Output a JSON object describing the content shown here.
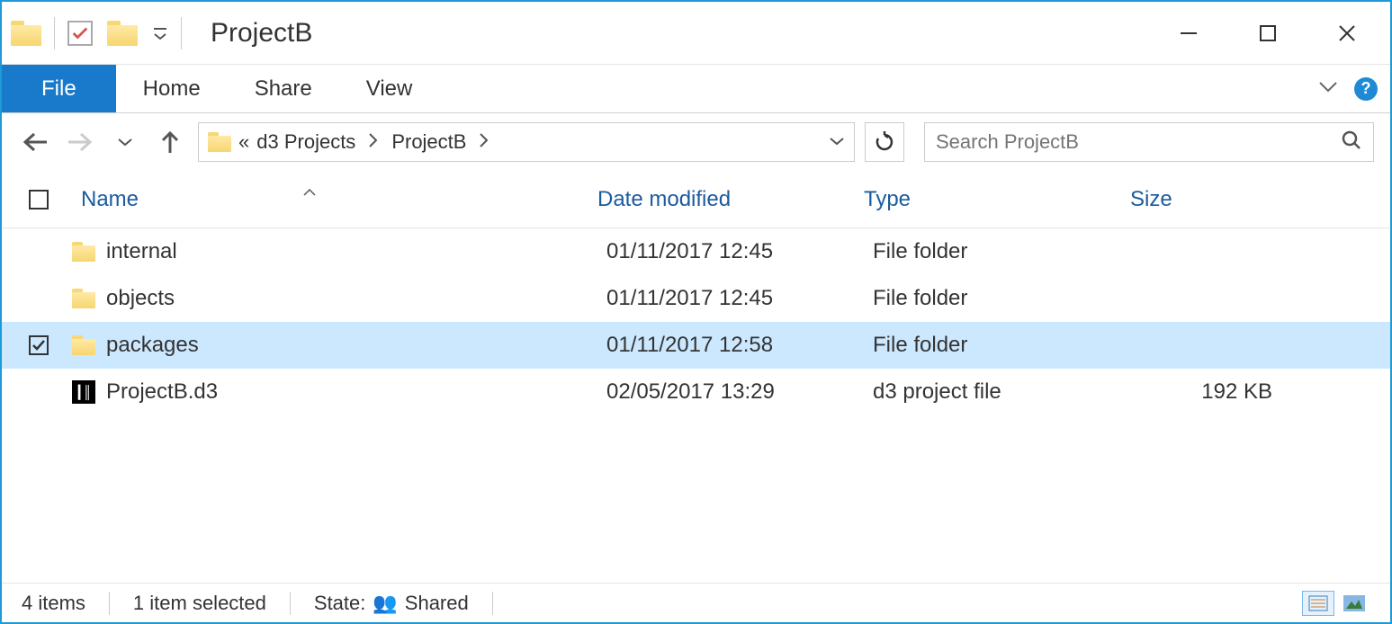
{
  "window": {
    "title": "ProjectB"
  },
  "ribbon": {
    "file": "File",
    "tabs": [
      "Home",
      "Share",
      "View"
    ]
  },
  "breadcrumb": {
    "prefix": "«",
    "items": [
      "d3 Projects",
      "ProjectB"
    ]
  },
  "search": {
    "placeholder": "Search ProjectB"
  },
  "columns": {
    "name": "Name",
    "date": "Date modified",
    "type": "Type",
    "size": "Size"
  },
  "rows": [
    {
      "name": "internal",
      "date": "01/11/2017 12:45",
      "type": "File folder",
      "size": "",
      "icon": "folder",
      "selected": false
    },
    {
      "name": "objects",
      "date": "01/11/2017 12:45",
      "type": "File folder",
      "size": "",
      "icon": "folder",
      "selected": false
    },
    {
      "name": "packages",
      "date": "01/11/2017 12:58",
      "type": "File folder",
      "size": "",
      "icon": "folder",
      "selected": true
    },
    {
      "name": "ProjectB.d3",
      "date": "02/05/2017 13:29",
      "type": "d3 project file",
      "size": "192 KB",
      "icon": "d3",
      "selected": false
    }
  ],
  "status": {
    "count": "4 items",
    "selected": "1 item selected",
    "state_label": "State:",
    "state_value": "Shared"
  }
}
